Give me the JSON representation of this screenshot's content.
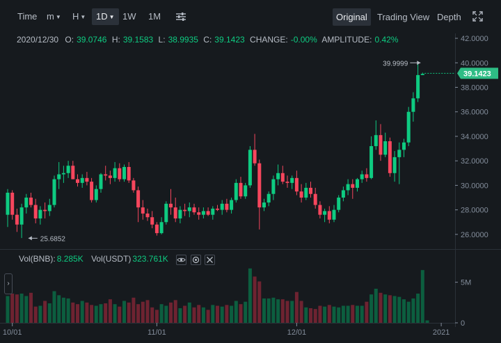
{
  "toolbar": {
    "intervals": [
      {
        "label": "Time",
        "caret": false,
        "active": false
      },
      {
        "label": "m",
        "caret": true,
        "active": false
      },
      {
        "label": "H",
        "caret": true,
        "active": false
      },
      {
        "label": "1D",
        "caret": true,
        "active": true
      },
      {
        "label": "1W",
        "caret": false,
        "active": false
      },
      {
        "label": "1M",
        "caret": false,
        "active": false
      }
    ],
    "settings_icon": "sliders-icon",
    "views": [
      {
        "label": "Original",
        "active": true
      },
      {
        "label": "Trading View",
        "active": false
      },
      {
        "label": "Depth",
        "active": false
      }
    ],
    "fullscreen_icon": "expand-icon"
  },
  "ohlc": {
    "date": "2020/12/30",
    "o_label": "O:",
    "o": "39.0746",
    "h_label": "H:",
    "h": "39.1583",
    "l_label": "L:",
    "l": "38.9935",
    "c_label": "C:",
    "c": "39.1423",
    "change_label": "CHANGE:",
    "change": "-0.00%",
    "amplitude_label": "AMPLITUDE:",
    "amplitude": "0.42%"
  },
  "volume_legend": {
    "bnb_label": "Vol(BNB):",
    "bnb": "8.285K",
    "usdt_label": "Vol(USDT)",
    "usdt": "323.761K",
    "icons": [
      "eye-icon",
      "settings-icon",
      "close-icon"
    ]
  },
  "colors": {
    "up": "#0ecb81",
    "down": "#f6465d",
    "background": "#161a1e",
    "grid": "#2b3139",
    "axis_text": "#848e9c"
  },
  "chart_data": [
    {
      "type": "candlestick",
      "y_ticks": [
        "42.0000",
        "40.0000",
        "38.0000",
        "36.0000",
        "34.0000",
        "32.0000",
        "30.0000",
        "28.0000",
        "26.0000"
      ],
      "ylim": [
        24.8,
        42.4
      ],
      "x_ticks": [
        {
          "label": "10/01",
          "index": 1
        },
        {
          "label": "11/01",
          "index": 32
        },
        {
          "label": "12/01",
          "index": 62
        },
        {
          "label": "2021",
          "index": 93
        }
      ],
      "current_price": "39.1423",
      "max_label": {
        "text": "39.9999",
        "index": 89,
        "value": 39.9999
      },
      "min_label": {
        "text": "25.6852",
        "index": 4,
        "value": 25.6852
      },
      "candles": [
        [
          27.6,
          29.7,
          26.6,
          29.4
        ],
        [
          29.4,
          29.6,
          27.2,
          27.6
        ],
        [
          27.6,
          28.1,
          26.2,
          26.8
        ],
        [
          26.8,
          28.5,
          25.7,
          28.2
        ],
        [
          28.2,
          29.3,
          27.7,
          29.0
        ],
        [
          29.0,
          29.4,
          28.2,
          28.4
        ],
        [
          28.4,
          28.9,
          26.9,
          27.3
        ],
        [
          27.3,
          28.3,
          26.8,
          28.0
        ],
        [
          28.0,
          28.6,
          27.3,
          27.9
        ],
        [
          27.9,
          28.9,
          27.5,
          28.4
        ],
        [
          28.4,
          30.8,
          28.2,
          30.5
        ],
        [
          30.5,
          31.9,
          29.7,
          30.9
        ],
        [
          30.9,
          31.6,
          30.2,
          31.0
        ],
        [
          31.0,
          32.0,
          30.6,
          31.6
        ],
        [
          31.6,
          32.0,
          30.5,
          30.5
        ],
        [
          30.5,
          30.9,
          29.9,
          30.2
        ],
        [
          30.2,
          30.9,
          29.8,
          30.6
        ],
        [
          30.6,
          31.1,
          30.0,
          30.3
        ],
        [
          30.3,
          30.6,
          28.6,
          28.8
        ],
        [
          28.8,
          30.0,
          28.6,
          29.7
        ],
        [
          29.7,
          31.0,
          29.4,
          30.9
        ],
        [
          30.9,
          31.6,
          30.4,
          30.8
        ],
        [
          30.8,
          31.2,
          30.1,
          30.6
        ],
        [
          30.6,
          31.9,
          30.3,
          31.4
        ],
        [
          31.4,
          31.8,
          30.3,
          30.5
        ],
        [
          30.5,
          31.7,
          30.3,
          31.5
        ],
        [
          31.5,
          31.9,
          30.2,
          30.4
        ],
        [
          30.4,
          30.6,
          29.4,
          29.6
        ],
        [
          29.6,
          29.9,
          27.0,
          28.2
        ],
        [
          28.2,
          28.8,
          27.2,
          27.7
        ],
        [
          27.7,
          28.1,
          27.1,
          27.4
        ],
        [
          27.4,
          27.9,
          26.5,
          26.8
        ],
        [
          26.8,
          27.0,
          25.9,
          26.1
        ],
        [
          26.1,
          27.4,
          26.0,
          27.0
        ],
        [
          27.0,
          28.7,
          26.8,
          28.5
        ],
        [
          28.5,
          29.7,
          27.6,
          28.2
        ],
        [
          28.2,
          29.0,
          27.0,
          27.3
        ],
        [
          27.3,
          28.3,
          26.9,
          28.0
        ],
        [
          28.0,
          28.5,
          27.5,
          27.9
        ],
        [
          27.9,
          28.6,
          27.4,
          28.2
        ],
        [
          28.2,
          28.5,
          27.6,
          27.8
        ],
        [
          27.8,
          28.2,
          27.2,
          27.6
        ],
        [
          27.6,
          28.2,
          27.3,
          27.9
        ],
        [
          27.9,
          28.2,
          27.5,
          27.6
        ],
        [
          27.6,
          28.3,
          27.2,
          28.1
        ],
        [
          28.1,
          28.4,
          27.9,
          28.0
        ],
        [
          28.0,
          28.8,
          27.6,
          28.5
        ],
        [
          28.5,
          28.9,
          27.8,
          28.0
        ],
        [
          28.0,
          29.0,
          27.7,
          28.8
        ],
        [
          28.8,
          30.5,
          28.6,
          30.2
        ],
        [
          30.2,
          30.7,
          28.9,
          29.1
        ],
        [
          29.1,
          30.2,
          28.9,
          30.0
        ],
        [
          30.0,
          33.2,
          29.8,
          32.9
        ],
        [
          32.9,
          34.2,
          31.6,
          31.8
        ],
        [
          31.8,
          32.1,
          26.4,
          28.2
        ],
        [
          28.2,
          28.9,
          27.9,
          28.6
        ],
        [
          28.6,
          29.5,
          28.3,
          29.3
        ],
        [
          29.3,
          30.8,
          28.8,
          30.5
        ],
        [
          30.5,
          31.7,
          30.0,
          31.0
        ],
        [
          31.0,
          31.6,
          30.1,
          30.3
        ],
        [
          30.3,
          30.8,
          29.8,
          30.2
        ],
        [
          30.2,
          30.8,
          29.7,
          30.6
        ],
        [
          30.6,
          31.2,
          29.2,
          29.5
        ],
        [
          29.5,
          30.1,
          28.6,
          29.0
        ],
        [
          29.0,
          30.2,
          28.8,
          29.8
        ],
        [
          29.8,
          30.3,
          29.0,
          29.3
        ],
        [
          29.3,
          29.8,
          28.1,
          28.4
        ],
        [
          28.4,
          28.7,
          27.3,
          27.6
        ],
        [
          27.6,
          28.1,
          27.0,
          27.9
        ],
        [
          27.9,
          28.3,
          26.9,
          27.2
        ],
        [
          27.2,
          28.4,
          27.0,
          28.0
        ],
        [
          28.0,
          29.2,
          27.8,
          29.0
        ],
        [
          29.0,
          29.9,
          28.7,
          29.6
        ],
        [
          29.6,
          30.5,
          29.2,
          30.1
        ],
        [
          30.1,
          30.5,
          28.9,
          29.8
        ],
        [
          29.8,
          30.6,
          29.5,
          30.5
        ],
        [
          30.5,
          31.2,
          30.2,
          30.9
        ],
        [
          30.9,
          31.4,
          30.3,
          30.6
        ],
        [
          30.6,
          34.0,
          30.5,
          33.2
        ],
        [
          33.2,
          35.3,
          32.9,
          34.1
        ],
        [
          34.1,
          35.0,
          32.0,
          32.5
        ],
        [
          32.5,
          34.3,
          32.3,
          33.6
        ],
        [
          33.6,
          33.9,
          30.7,
          31.0
        ],
        [
          31.0,
          32.8,
          30.3,
          32.3
        ],
        [
          32.3,
          33.5,
          30.1,
          32.9
        ],
        [
          32.9,
          33.8,
          32.3,
          33.5
        ],
        [
          33.5,
          36.4,
          33.2,
          36.0
        ],
        [
          36.0,
          37.6,
          35.2,
          37.1
        ],
        [
          37.1,
          40.0,
          36.8,
          39.0
        ],
        [
          39.0,
          39.2,
          39.0,
          39.1
        ]
      ]
    },
    {
      "type": "bar",
      "name": "Vol(BNB)",
      "y_ticks": [
        "5M",
        "0"
      ],
      "values": [
        3.3,
        3.6,
        3.5,
        3.6,
        3.3,
        3.7,
        2.0,
        2.1,
        2.7,
        2.4,
        3.9,
        3.4,
        3.1,
        3.0,
        2.5,
        2.3,
        2.7,
        2.5,
        2.2,
        2.1,
        2.3,
        2.4,
        2.9,
        2.3,
        2.0,
        2.7,
        2.5,
        3.1,
        2.3,
        2.6,
        2.8,
        1.9,
        1.6,
        2.3,
        2.1,
        2.5,
        2.8,
        1.8,
        2.1,
        2.5,
        1.9,
        2.2,
        1.9,
        1.6,
        2.2,
        2.1,
        2.0,
        2.2,
        2.1,
        2.7,
        2.3,
        2.6,
        6.7,
        5.7,
        5.1,
        3.0,
        3.0,
        3.1,
        2.9,
        2.9,
        2.7,
        2.7,
        3.8,
        2.7,
        1.9,
        1.8,
        1.7,
        2.1,
        2.0,
        2.2,
        2.0,
        1.9,
        2.1,
        2.1,
        2.2,
        2.1,
        2.1,
        2.6,
        3.5,
        4.2,
        3.7,
        3.5,
        3.4,
        3.3,
        3.2,
        2.9,
        2.6,
        3.0,
        3.6,
        6.5,
        0.3
      ]
    }
  ]
}
